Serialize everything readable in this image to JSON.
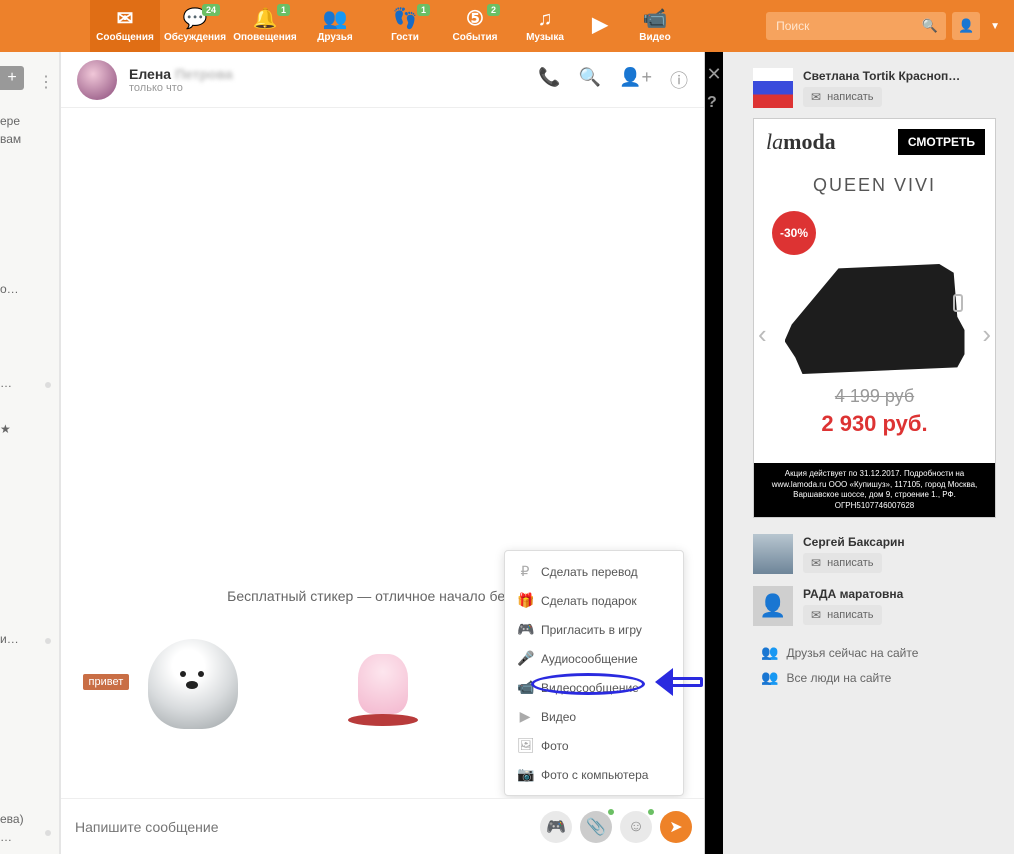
{
  "nav": {
    "messages": {
      "label": "Сообщения"
    },
    "discussions": {
      "label": "Обсуждения",
      "badge": "24"
    },
    "notifications": {
      "label": "Оповещения",
      "badge": "1"
    },
    "friends": {
      "label": "Друзья"
    },
    "guests": {
      "label": "Гости",
      "badge": "1"
    },
    "events": {
      "label": "События",
      "badge": "2"
    },
    "music": {
      "label": "Музыка"
    },
    "play": {
      "label": ""
    },
    "video": {
      "label": "Видео"
    },
    "search_placeholder": "Поиск"
  },
  "left": {
    "snips": [
      "ере",
      "вам",
      "о…",
      "…",
      "…",
      "и…",
      "ева)",
      "…"
    ]
  },
  "chat": {
    "name": "Елена",
    "name_blurred": "Петрова",
    "time": "только что",
    "intro": "Бесплатный стикер — отличное начало беседы",
    "sticker_hello": "привет",
    "compose_placeholder": "Напишите сообщение"
  },
  "attach": {
    "transfer": "Сделать перевод",
    "gift": "Сделать подарок",
    "game": "Пригласить в игру",
    "audio": "Аудиосообщение",
    "video_msg": "Видеосообщение",
    "video": "Видео",
    "photo": "Фото",
    "photo_pc": "Фото с компьютера"
  },
  "right": {
    "friend1": {
      "name": "Светлана Tortik Красноп…",
      "btn": "написать"
    },
    "friend2": {
      "name": "Сергей Баксарин",
      "btn": "написать"
    },
    "friend3": {
      "name": "РАДА маратовна",
      "btn": "написать"
    },
    "links": {
      "online": "Друзья сейчас на сайте",
      "all": "Все люди на сайте"
    }
  },
  "ad": {
    "logo_i": "la",
    "logo_b": "moda",
    "view": "СМОТРЕТЬ",
    "brand": "QUEEN VIVI",
    "sale": "-30%",
    "old_price": "4 199 руб",
    "new_price": "2 930 руб.",
    "legal": "Акция действует по 31.12.2017. Подробности на www.lamoda.ru ООО «Купишуз», 117105, город Москва, Варшавское шоссе, дом 9, строение 1., РФ. ОГРН5107746007628"
  }
}
